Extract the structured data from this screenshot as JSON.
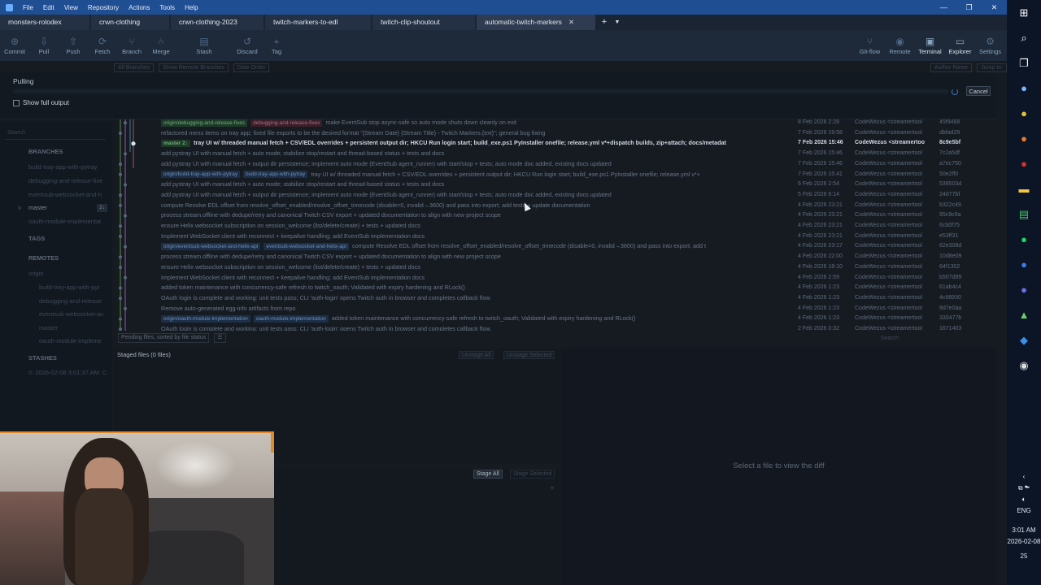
{
  "menubar": {
    "items": [
      "File",
      "Edit",
      "View",
      "Repository",
      "Actions",
      "Tools",
      "Help"
    ],
    "controls": [
      "—",
      "❐",
      "✕"
    ]
  },
  "tabs": [
    {
      "label": "monsters-rolodex"
    },
    {
      "label": "crwn-clothing"
    },
    {
      "label": "crwn-clothing-2023"
    },
    {
      "label": "twitch-markers-to-edl"
    },
    {
      "label": "twitch-clip-shoutout"
    },
    {
      "label": "automatic-twitch-markers",
      "active": true
    }
  ],
  "toolbar": {
    "left": [
      {
        "label": "Commit",
        "icon": "commit-icon",
        "glyph": "⊕"
      },
      {
        "label": "Pull",
        "icon": "pull-icon",
        "glyph": "⇩"
      },
      {
        "label": "Push",
        "icon": "push-icon",
        "glyph": "⇧"
      },
      {
        "label": "Fetch",
        "icon": "fetch-icon",
        "glyph": "⟳"
      },
      {
        "label": "Branch",
        "icon": "branch-icon",
        "glyph": "⑂"
      },
      {
        "label": "Merge",
        "icon": "merge-icon",
        "glyph": "⑃"
      },
      {
        "label": "Stash",
        "icon": "stash-icon",
        "glyph": "▤"
      },
      {
        "label": "Discard",
        "icon": "discard-icon",
        "glyph": "↺"
      },
      {
        "label": "Tag",
        "icon": "tag-icon",
        "glyph": "⌖"
      }
    ],
    "right": [
      {
        "label": "Git-flow",
        "icon": "git-flow-icon",
        "glyph": "⑂"
      },
      {
        "label": "Remote",
        "icon": "remote-icon",
        "glyph": "◉"
      },
      {
        "label": "Terminal",
        "icon": "terminal-icon",
        "glyph": "▣"
      },
      {
        "label": "Explorer",
        "icon": "explorer-icon",
        "glyph": "▭"
      },
      {
        "label": "Settings",
        "icon": "settings-icon",
        "glyph": "⚙"
      }
    ]
  },
  "subbar": {
    "branches": "All Branches",
    "remote": "Show Remote Branches",
    "order": "Date Order",
    "author": "Author Name",
    "jump": "Jump to:"
  },
  "pull": {
    "title": "Pulling",
    "cancel": "Cancel",
    "full_output": "Show full output"
  },
  "sidebar": {
    "search": "Search",
    "branches_head": "BRANCHES",
    "branches": [
      {
        "name": "build-tray-app-with-pytray"
      },
      {
        "name": "debugging-and-release-fixe"
      },
      {
        "name": "eventsub-websocket-and-h"
      },
      {
        "name": "master",
        "selected": true,
        "badge": "2↓"
      },
      {
        "name": "oauth-module-implementat"
      }
    ],
    "tags_head": "TAGS",
    "remotes_head": "REMOTES",
    "origin": "origin",
    "remote_branches": [
      "build-tray-app-with-pyt",
      "debugging-and-release",
      "eventsub-websocket-an",
      "master",
      "oauth-module-impleme"
    ],
    "stashes_head": "STASHES",
    "stash_item": "0: 2026-02-08 3:01:37 AM: C"
  },
  "commits": [
    {
      "refs": [
        {
          "t": "origin/debugging-and-release-fixes",
          "c": "g"
        },
        {
          "t": "debugging-and-release-fixes",
          "c": "r"
        }
      ],
      "msg": "make EventSub stop async-safe so auto mode shuts down cleanly on exit",
      "date": "8 Feb 2026 2:28",
      "author": "CodeWezus <streamertool",
      "sha": "45f9468"
    },
    {
      "refs": [],
      "msg": "refactored menu items on tray app; fixed file exports to be the desired format \"{Stream Date} {Stream Title} - Twitch Markers.{ext}\"; general bug fixing",
      "date": "7 Feb 2026 19:58",
      "author": "CodeWezus <streamertool",
      "sha": "dbfad29"
    },
    {
      "refs": [
        {
          "t": "master 2↓",
          "c": "g"
        }
      ],
      "msg": "tray UI w/ threaded manual fetch + CSV/EDL overrides + persistent output dir; HKCU Run login start; build_exe.ps1 PyInstaller onefile; release.yml v*+dispatch builds, zip+attach; docs/metadat",
      "date": "7 Feb 2026 15:46",
      "author": "CodeWezus <streamertoo",
      "sha": "8c9e5bf",
      "head": true
    },
    {
      "refs": [],
      "msg": "add pystray UI with manual fetch + auto mode; stabilize stop/restart and thread-based status + tests and docs",
      "date": "7 Feb 2026 15:46",
      "author": "CodeWezus <streamertool",
      "sha": "7c2a5df"
    },
    {
      "refs": [],
      "msg": "add pystray UI with manual fetch + output dir persistence; implement auto mode (EventSub agent_runner) with start/stop + tests; auto mode doc added, existing docs updated",
      "date": "7 Feb 2026 15:46",
      "author": "CodeWezus <streamertool",
      "sha": "a7ec750"
    },
    {
      "refs": [
        {
          "t": "origin/build-tray-app-with-pytray",
          "c": "b"
        },
        {
          "t": "build-tray-app-with-pytray",
          "c": "b"
        }
      ],
      "msg": "tray UI w/ threaded manual fetch + CSV/EDL overrides + persistent output dir; HKCU Run login start; build_exe.ps1 PyInstaller onefile; release.yml v*+",
      "date": "7 Feb 2026 15:41",
      "author": "CodeWezus <streamertool",
      "sha": "50e2ff0"
    },
    {
      "refs": [],
      "msg": "add pystray UI with manual fetch + auto mode; stabilize stop/restart and thread-based status + tests and docs",
      "date": "6 Feb 2026 2:54",
      "author": "CodeWezus <streamertool",
      "sha": "539503d"
    },
    {
      "refs": [],
      "msg": "add pystray UI with manual fetch + output dir persistence; implement auto mode (EventSub agent_runner) with start/stop + tests; auto mode doc added, existing docs updated",
      "date": "5 Feb 2026 6:14",
      "author": "CodeWezus <streamertool",
      "sha": "24d77bf"
    },
    {
      "refs": [],
      "msg": "compute Resolve EDL offset from resolve_offset_enabled/resolve_offset_timecode (disable=0, invalid→3600) and pass into export; add tests + update documentation",
      "date": "4 Feb 2026 23:21",
      "author": "CodeWezus <streamertool",
      "sha": "b322c49"
    },
    {
      "refs": [],
      "msg": "process stream.offline with dedupe/retry and canonical Twitch CSV export + updated documentation to align with new project scope",
      "date": "4 Feb 2026 23:21",
      "author": "CodeWezus <streamertool",
      "sha": "95c9c0a"
    },
    {
      "refs": [],
      "msg": "ensure Helix websocket subscription on session_welcome (list/delete/create) + tests + updated docs",
      "date": "4 Feb 2026 23:21",
      "author": "CodeWezus <streamertool",
      "sha": "6cb0f75"
    },
    {
      "refs": [],
      "msg": "Implement WebSocket client with reconnect + keepalive handling; add EventSub implementation docs",
      "date": "4 Feb 2026 23:21",
      "author": "CodeWezus <streamertool",
      "sha": "e53ff31"
    },
    {
      "refs": [
        {
          "t": "origin/eventsub-websocket-and-helix-api",
          "c": "b"
        },
        {
          "t": "eventsub-websocket-and-helix-api",
          "c": "b"
        }
      ],
      "msg": "compute Resolve EDL offset from resolve_offset_enabled/resolve_offset_timecode (disable=0, invalid→3600) and pass into export; add t",
      "date": "4 Feb 2026 23:17",
      "author": "CodeWezus <streamertool",
      "sha": "62e308d"
    },
    {
      "refs": [],
      "msg": "process stream.offline with dedupe/retry and canonical Twitch CSV export + updated documentation to align with new project scope",
      "date": "4 Feb 2026 22:00",
      "author": "CodeWezus <streamertool",
      "sha": "10d8e09"
    },
    {
      "refs": [],
      "msg": "ensure Helix websocket subscription on session_welcome (list/delete/create) + tests + updated docs",
      "date": "4 Feb 2026 18:10",
      "author": "CodeWezus <streamertool",
      "sha": "64f1302"
    },
    {
      "refs": [],
      "msg": "Implement WebSocket client with reconnect + keepalive handling; add EventSub implementation docs",
      "date": "4 Feb 2026 2:59",
      "author": "CodeWezus <streamertool",
      "sha": "b507d99"
    },
    {
      "refs": [],
      "msg": "added token maintenance with concurrency-safe refresh to twitch_oauth; Validated with expiry hardening and RLock()",
      "date": "4 Feb 2026 1:23",
      "author": "CodeWezus <streamertool",
      "sha": "61ab4c4"
    },
    {
      "refs": [],
      "msg": "OAuth login is complete and working: unit tests pass; CLI 'auth-login' opens Twitch auth in browser and completes callback flow.",
      "date": "4 Feb 2026 1:23",
      "author": "CodeWezus <streamertool",
      "sha": "4c68930"
    },
    {
      "refs": [],
      "msg": "Remove auto-generated egg-info artifacts from repo",
      "date": "4 Feb 2026 1:23",
      "author": "CodeWezus <streamertool",
      "sha": "9d7e0aa"
    },
    {
      "refs": [
        {
          "t": "origin/oauth-module-implementation",
          "c": "b"
        },
        {
          "t": "oauth-module-implementation",
          "c": "b"
        }
      ],
      "msg": "added token maintenance with concurrency-safe refresh to twitch_oauth; Validated with expiry hardening and RLock()",
      "date": "4 Feb 2026 1:23",
      "author": "CodeWezus <streamertool",
      "sha": "330477b"
    },
    {
      "refs": [],
      "msg": "OAuth login is complete and working: unit tests pass; CLI 'auth-login' opens Twitch auth in browser and completes callback flow.",
      "date": "2 Feb 2026 0:32",
      "author": "CodeWezus <streamertool",
      "sha": "1671403"
    }
  ],
  "pending": {
    "sort": "Pending files, sorted by file status",
    "list_icon": "☰",
    "search": "Search"
  },
  "staged": {
    "header": "Staged files   (0 files)",
    "unstage_all": "Unstage All",
    "unstage_selected": "Unstage Selected",
    "stage_all": "Stage All",
    "stage_selected": "Stage Selected"
  },
  "diff": {
    "empty": "Select a file to view the diff"
  },
  "taskbar": {
    "icons": [
      {
        "name": "start-icon",
        "glyph": "⊞",
        "color": "#ffffff"
      },
      {
        "name": "search-icon",
        "glyph": "⌕",
        "color": "#ffffff"
      },
      {
        "name": "task-view-icon",
        "glyph": "❐",
        "color": "#ffffff"
      },
      {
        "name": "copilot-icon",
        "glyph": "●",
        "color": "#7ab8ff"
      },
      {
        "name": "chrome-icon",
        "glyph": "●",
        "color": "#e3c23a"
      },
      {
        "name": "firefox-icon",
        "glyph": "●",
        "color": "#f07a2a"
      },
      {
        "name": "record-icon",
        "glyph": "●",
        "color": "#e03030"
      },
      {
        "name": "file-explorer-icon",
        "glyph": "▬",
        "color": "#f5c542"
      },
      {
        "name": "notepad-icon",
        "glyph": "▤",
        "color": "#48c36b"
      },
      {
        "name": "spotify-icon",
        "glyph": "●",
        "color": "#1ed760"
      },
      {
        "name": "maps-icon",
        "glyph": "●",
        "color": "#3a7ee8"
      },
      {
        "name": "discord-icon",
        "glyph": "●",
        "color": "#6872f0"
      },
      {
        "name": "sourcetree-icon",
        "glyph": "▲",
        "color": "#6ad26a"
      },
      {
        "name": "vscode-icon",
        "glyph": "◆",
        "color": "#3a8fe8"
      },
      {
        "name": "obs-icon",
        "glyph": "◉",
        "color": "#dddddd"
      }
    ],
    "language": "ENG",
    "time": "3:01 AM",
    "date": "2026-02-08",
    "notifications": "25"
  }
}
